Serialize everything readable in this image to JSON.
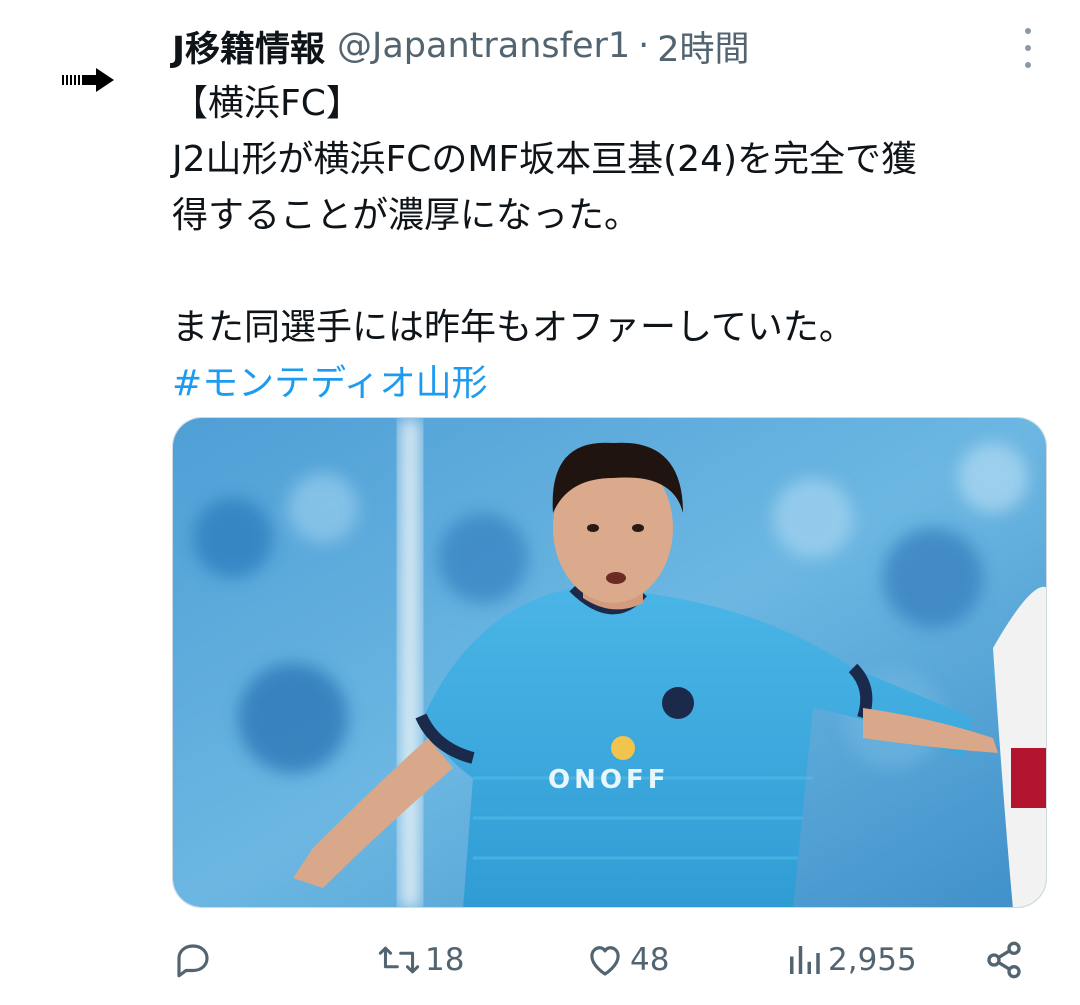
{
  "tweet": {
    "author": {
      "name": "J移籍情報",
      "handle": "@Japantransfer1",
      "separator": "·",
      "time": "2時間"
    },
    "text_lines": [
      "【横浜FC】",
      "J2山形が横浜FCのMF坂本亘基(24)を完全で獲",
      "得することが濃厚になった。",
      "",
      "また同選手には昨年もオファーしていた。"
    ],
    "hashtag": "#モンテディオ山形",
    "media": {
      "jersey_text": "ONOFF",
      "colors": {
        "jersey": "#3fa9de",
        "background": "#5aaad8",
        "trim": "#1b2a4a"
      }
    },
    "actions": {
      "reply_icon": "reply-icon",
      "retweet_icon": "retweet-icon",
      "retweet_count": "18",
      "like_icon": "heart-icon",
      "like_count": "48",
      "views_icon": "views-icon",
      "views_count": "2,955",
      "share_icon": "share-icon"
    },
    "colors": {
      "text": "#0f1419",
      "muted": "#536471",
      "link": "#1d9bf0"
    }
  }
}
